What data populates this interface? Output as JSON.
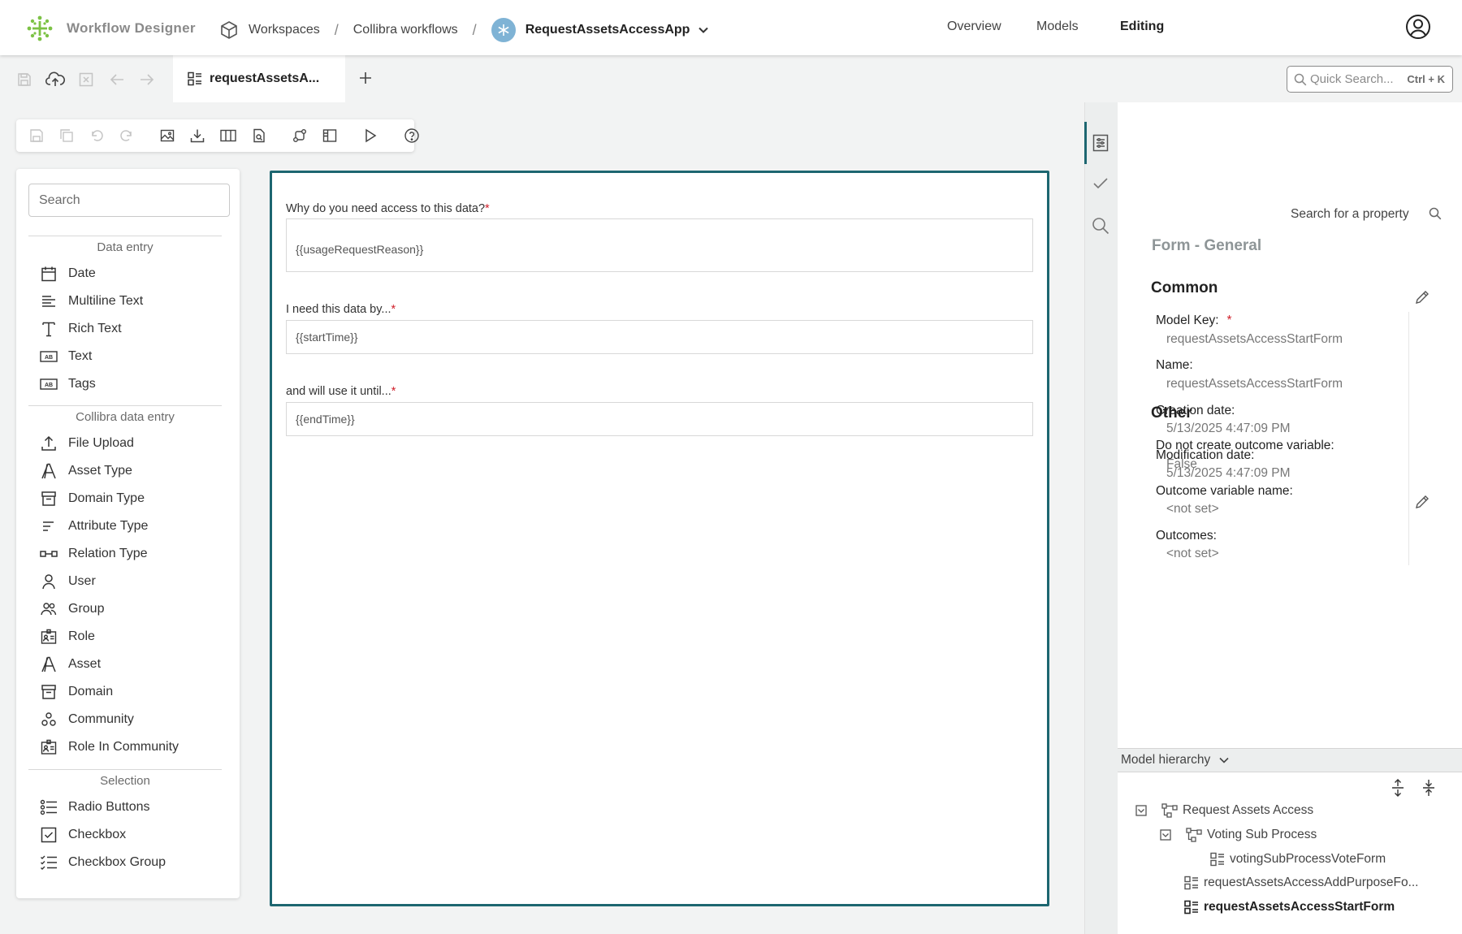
{
  "app": {
    "name": "Workflow Designer"
  },
  "breadcrumb": {
    "workspaces": "Workspaces",
    "collection": "Collibra workflows",
    "app": "RequestAssetsAccessApp"
  },
  "nav": {
    "overview": "Overview",
    "models": "Models",
    "editing": "Editing"
  },
  "tabs": [
    {
      "label": "requestAssetsA..."
    }
  ],
  "quick_search": {
    "placeholder": "Quick Search...",
    "shortcut": "Ctrl + K"
  },
  "palette": {
    "search_placeholder": "Search",
    "sections": [
      {
        "title": "Data entry",
        "items": [
          {
            "label": "Date",
            "icon": "calendar-icon"
          },
          {
            "label": "Multiline Text",
            "icon": "multiline-text-icon"
          },
          {
            "label": "Rich Text",
            "icon": "rich-text-icon"
          },
          {
            "label": "Text",
            "icon": "text-field-icon"
          },
          {
            "label": "Tags",
            "icon": "tags-icon"
          }
        ]
      },
      {
        "title": "Collibra data entry",
        "items": [
          {
            "label": "File Upload",
            "icon": "upload-icon"
          },
          {
            "label": "Asset Type",
            "icon": "asset-type-icon"
          },
          {
            "label": "Domain Type",
            "icon": "domain-type-icon"
          },
          {
            "label": "Attribute Type",
            "icon": "attribute-type-icon"
          },
          {
            "label": "Relation Type",
            "icon": "relation-type-icon"
          },
          {
            "label": "User",
            "icon": "user-icon"
          },
          {
            "label": "Group",
            "icon": "group-icon"
          },
          {
            "label": "Role",
            "icon": "role-icon"
          },
          {
            "label": "Asset",
            "icon": "asset-icon"
          },
          {
            "label": "Domain",
            "icon": "domain-icon"
          },
          {
            "label": "Community",
            "icon": "community-icon"
          },
          {
            "label": "Role In Community",
            "icon": "role-in-community-icon"
          }
        ]
      },
      {
        "title": "Selection",
        "items": [
          {
            "label": "Radio Buttons",
            "icon": "radio-list-icon"
          },
          {
            "label": "Checkbox",
            "icon": "checkbox-icon"
          },
          {
            "label": "Checkbox Group",
            "icon": "checkbox-group-icon"
          }
        ]
      }
    ]
  },
  "form": {
    "fields": [
      {
        "label": "Why do you need access to this data?",
        "required": "*",
        "value": "{{usageRequestReason}}"
      },
      {
        "label": "I need this data by...",
        "required": "*",
        "value": "{{startTime}}"
      },
      {
        "label": "and will use it until...",
        "required": "*",
        "value": "{{endTime}}"
      }
    ]
  },
  "properties": {
    "search_placeholder": "Search for a property",
    "title": "Form - General",
    "common": {
      "title": "Common",
      "model_key_label": "Model Key:",
      "model_key_required": "*",
      "model_key": "requestAssetsAccessStartForm",
      "name_label": "Name:",
      "name": "requestAssetsAccessStartForm",
      "creation_label": "Creation date:",
      "creation": "5/13/2025 4:47:09 PM",
      "modification_label": "Modification date:",
      "modification": "5/13/2025 4:47:09 PM"
    },
    "other": {
      "title": "Other",
      "no_outcome_label": "Do not create outcome variable:",
      "no_outcome": "False",
      "outcome_name_label": "Outcome variable name:",
      "outcome_name": "<not set>",
      "outcomes_label": "Outcomes:",
      "outcomes": "<not set>"
    }
  },
  "hierarchy": {
    "title": "Model hierarchy",
    "nodes": [
      {
        "label": "Request Assets Access"
      },
      {
        "label": "Voting Sub Process"
      },
      {
        "label": "votingSubProcessVoteForm"
      },
      {
        "label": "requestAssetsAccessAddPurposeFo..."
      },
      {
        "label": "requestAssetsAccessStartForm"
      }
    ]
  },
  "colors": {
    "accent": "#1d6670",
    "required": "#d0202b",
    "logo": "#7cc245"
  }
}
